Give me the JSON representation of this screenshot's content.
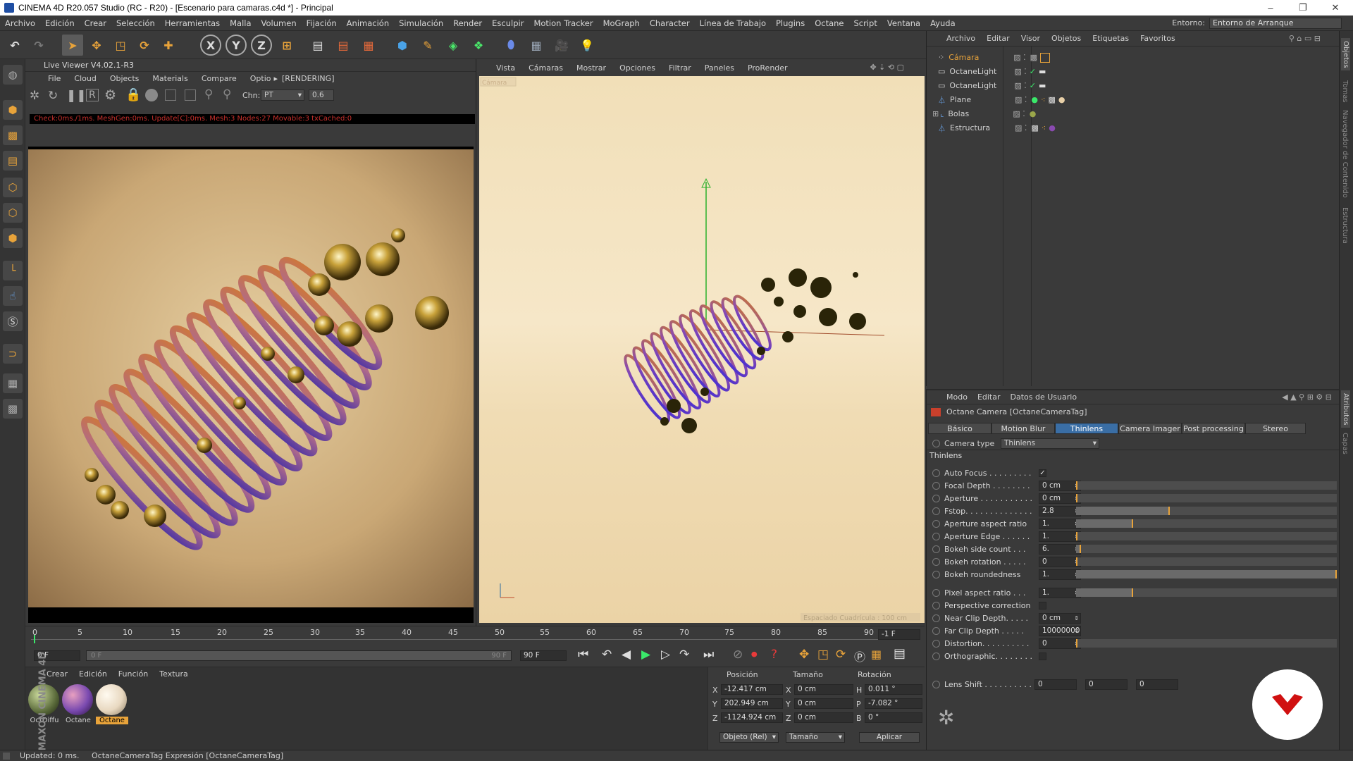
{
  "window": {
    "title": "CINEMA 4D R20.057 Studio (RC - R20) - [Escenario para camaras.c4d *] - Principal",
    "controls": [
      "–",
      "❐",
      "✕"
    ]
  },
  "menubar": {
    "items": [
      "Archivo",
      "Edición",
      "Crear",
      "Selección",
      "Herramientas",
      "Malla",
      "Volumen",
      "Fijación",
      "Animación",
      "Simulación",
      "Render",
      "Esculpir",
      "Motion Tracker",
      "MoGraph",
      "Character",
      "Línea de Trabajo",
      "Plugins",
      "Octane",
      "Script",
      "Ventana",
      "Ayuda"
    ],
    "environment_label": "Entorno:",
    "environment_value": "Entorno de Arranque"
  },
  "toolbar": {
    "icons": [
      "undo-icon",
      "redo-icon",
      "select-icon",
      "move-icon",
      "scale-icon",
      "rotate-icon",
      "add-icon",
      "x-axis-icon",
      "y-axis-icon",
      "z-axis-icon",
      "world-coords-icon",
      "render-view-icon",
      "render-picture-icon",
      "render-settings-icon",
      "cube-icon",
      "pen-icon",
      "subdivision-icon",
      "array-icon",
      "deformer-icon",
      "floor-icon",
      "camera-icon",
      "light-icon"
    ],
    "axis_labels": [
      "X",
      "Y",
      "Z"
    ]
  },
  "live_viewer": {
    "title": "Live Viewer V4.02.1-R3",
    "menu": [
      "File",
      "Cloud",
      "Objects",
      "Materials",
      "Compare",
      "Optio"
    ],
    "state": "[RENDERING]",
    "channel_label": "Chn:",
    "channel_value": "PT",
    "exposure_value": "0.6",
    "status": "Check:0ms./1ms. MeshGen:0ms. Update[C]:0ms. Mesh:3 Nodes:27 Movable:3 txCached:0"
  },
  "viewport": {
    "menu": [
      "Vista",
      "Cámaras",
      "Mostrar",
      "Opciones",
      "Filtrar",
      "Paneles",
      "ProRender"
    ],
    "camera_label": "Cámara",
    "grid_label": "Espaciado Cuadrícula : 100 cm"
  },
  "timeline": {
    "ticks": [
      "0",
      "5",
      "10",
      "15",
      "20",
      "25",
      "30",
      "35",
      "40",
      "45",
      "50",
      "55",
      "60",
      "65",
      "70",
      "75",
      "80",
      "85",
      "90"
    ],
    "end_frame_display": "-1 F",
    "start_field": "0 F",
    "range_start": "0 F",
    "range_end": "90 F",
    "end_field": "90 F"
  },
  "materials": {
    "menu": [
      "Crear",
      "Edición",
      "Función",
      "Textura"
    ],
    "items": [
      {
        "label": "OctDiffu",
        "color": "#5a6a3a"
      },
      {
        "label": "Octane",
        "color": "#7a4ab0"
      },
      {
        "label": "Octane",
        "color": "#e8d8c0"
      }
    ],
    "brand": "MAXON CINEMA 4D"
  },
  "coordinates": {
    "headers": [
      "Posición",
      "Tamaño",
      "Rotación"
    ],
    "rows": [
      {
        "axis": "X",
        "pos": "-12.417 cm",
        "size_axis": "X",
        "size": "0 cm",
        "rot_axis": "H",
        "rot": "0.011 °"
      },
      {
        "axis": "Y",
        "pos": "202.949 cm",
        "size_axis": "Y",
        "size": "0 cm",
        "rot_axis": "P",
        "rot": "-7.082 °"
      },
      {
        "axis": "Z",
        "pos": "-1124.924 cm",
        "size_axis": "Z",
        "size": "0 cm",
        "rot_axis": "B",
        "rot": "0 °"
      }
    ],
    "mode_select": "Objeto (Rel)",
    "size_select": "Tamaño",
    "apply_button": "Aplicar"
  },
  "object_manager": {
    "menu": [
      "Archivo",
      "Editar",
      "Visor",
      "Objetos",
      "Etiquetas",
      "Favoritos"
    ],
    "objects": [
      {
        "name": "Cámara",
        "highlight": true
      },
      {
        "name": "OctaneLight",
        "highlight": false
      },
      {
        "name": "OctaneLight",
        "highlight": false
      },
      {
        "name": "Plane",
        "highlight": false
      },
      {
        "name": "Bolas",
        "highlight": false
      },
      {
        "name": "Estructura",
        "highlight": false
      }
    ]
  },
  "attributes": {
    "menu": [
      "Modo",
      "Editar",
      "Datos de Usuario"
    ],
    "title": "Octane Camera [OctaneCameraTag]",
    "tabs": [
      "Básico",
      "Motion Blur",
      "Thinlens",
      "Camera Imager",
      "Post processing",
      "Stereo"
    ],
    "active_tab": "Thinlens",
    "camera_type_label": "Camera type",
    "camera_type_value": "Thinlens",
    "section": "Thinlens",
    "params": [
      {
        "label": "Auto Focus . . . . . . . . .",
        "value": "✓",
        "type": "check",
        "fill": null
      },
      {
        "label": "Focal Depth . . . . . . . .",
        "value": "0 cm",
        "type": "field",
        "fill": 0.0
      },
      {
        "label": "Aperture . . . . . . . . . . .",
        "value": "0 cm",
        "type": "field",
        "fill": 0.0
      },
      {
        "label": "Fstop. . . . . . . . . . . . . .",
        "value": "2.8",
        "type": "field",
        "fill": 0.36
      },
      {
        "label": "Aperture aspect ratio",
        "value": "1.",
        "type": "field",
        "fill": 0.22
      },
      {
        "label": "Aperture Edge . . . . . .",
        "value": "1.",
        "type": "field",
        "fill": 0.0
      },
      {
        "label": "Bokeh side count . . .",
        "value": "6.",
        "type": "field",
        "fill": 0.02
      },
      {
        "label": "Bokeh rotation . . . . .",
        "value": "0",
        "type": "field",
        "fill": 0.0
      },
      {
        "label": "Bokeh roundedness",
        "value": "1.",
        "type": "field",
        "fill": 1.0
      },
      {
        "label": "Pixel aspect ratio . . .",
        "value": "1.",
        "type": "field",
        "fill": 0.22
      },
      {
        "label": "Perspective correction",
        "value": "",
        "type": "check",
        "fill": null
      },
      {
        "label": "Near Clip Depth. . . . .",
        "value": "0 cm",
        "type": "field",
        "fill": null
      },
      {
        "label": "Far Clip Depth . . . . .",
        "value": "10000000",
        "type": "field",
        "fill": null
      },
      {
        "label": "Distortion. . . . . . . . . .",
        "value": "0",
        "type": "field",
        "fill": 0.0
      },
      {
        "label": "Orthographic. . . . . . . .",
        "value": "",
        "type": "check",
        "fill": null
      }
    ],
    "lens_shift_label": "Lens Shift . . . . . . . . . .",
    "lens_shift_values": [
      "0",
      "0",
      "0"
    ]
  },
  "right_strip": [
    "Objetos",
    "Tomas",
    "Navegador de Contenido",
    "Estructura",
    "Atributos",
    "Capas"
  ],
  "statusbar": {
    "left": "Updated: 0 ms.",
    "right": "OctaneCameraTag Expresión [OctaneCameraTag]"
  },
  "colors": {
    "panel_bg": "#3a3a3a",
    "accent_orange": "#e8a33a",
    "selection_blue": "#3a6ea5",
    "status_red": "#c9302c"
  }
}
